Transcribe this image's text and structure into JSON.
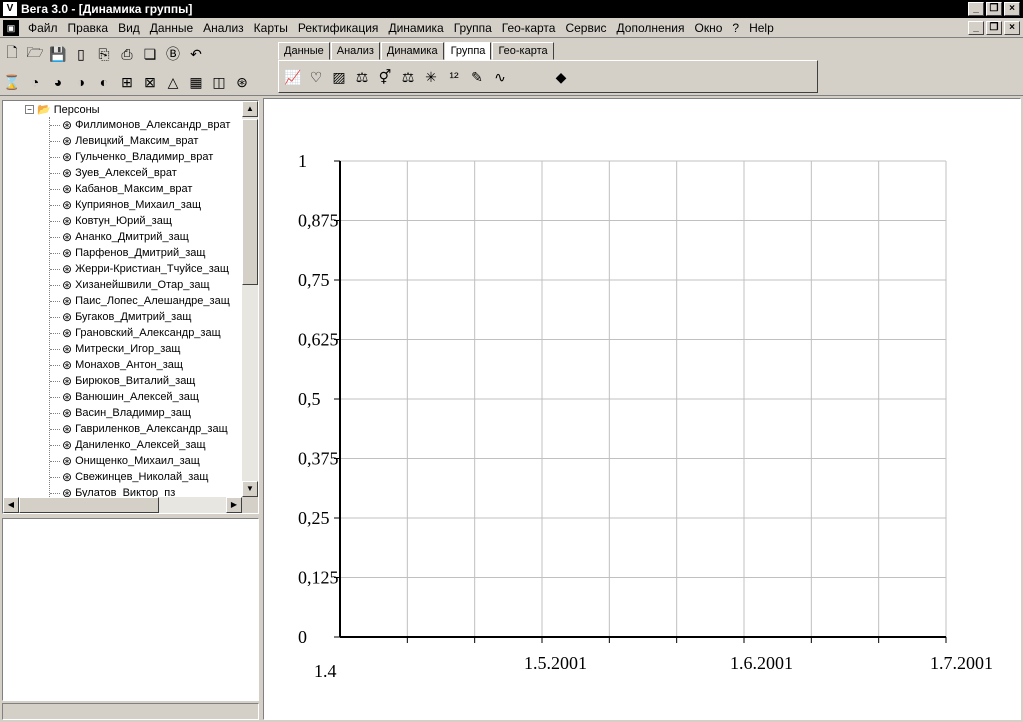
{
  "window": {
    "title": "Вега 3.0 - [Динамика группы]",
    "app_icon": "vega-app-icon"
  },
  "menubar": {
    "items": [
      "Файл",
      "Правка",
      "Вид",
      "Данные",
      "Анализ",
      "Карты",
      "Ректификация",
      "Динамика",
      "Группа",
      "Гео-карта",
      "Сервис",
      "Дополнения",
      "Окно",
      "?",
      "Help"
    ]
  },
  "toolbar_tabs": {
    "tabs": [
      "Данные",
      "Анализ",
      "Динамика",
      "Группа",
      "Гео-карта"
    ],
    "active": "Группа"
  },
  "tree": {
    "root_label": "Персоны",
    "items": [
      "Филлимонов_Александр_врат",
      "Левицкий_Максим_врат",
      "Гульченко_Владимир_врат",
      "Зуев_Алексей_врат",
      "Кабанов_Максим_врат",
      "Куприянов_Михаил_защ",
      "Ковтун_Юрий_защ",
      "Ананко_Дмитрий_защ",
      "Парфенов_Дмитрий_защ",
      "Жерри-Кристиан_Тчуйсе_защ",
      "Хизанейшвили_Отар_защ",
      "Паис_Лопес_Алешандре_защ",
      "Бугаков_Дмитрий_защ",
      "Грановский_Александр_защ",
      "Митрески_Игор_защ",
      "Монахов_Антон_защ",
      "Бирюков_Виталий_защ",
      "Ванюшин_Алексей_защ",
      "Васин_Владимир_защ",
      "Гавриленков_Александр_защ",
      "Даниленко_Алексей_защ",
      "Онищенко_Михаил_защ",
      "Свежинцев_Николай_защ",
      "Булатов_Виктор_пз"
    ]
  },
  "chart_data": {
    "type": "line",
    "title": "",
    "xlabel": "",
    "ylabel": "",
    "ylim": [
      0,
      1
    ],
    "y_ticks": [
      "0",
      "0,125",
      "0,25",
      "0,375",
      "0,5",
      "0,625",
      "0,75",
      "0,875",
      "1"
    ],
    "x_ticks": [
      "1.4",
      "1.5.2001",
      "1.6.2001",
      "1.7.2001"
    ],
    "grid": true,
    "series": []
  }
}
